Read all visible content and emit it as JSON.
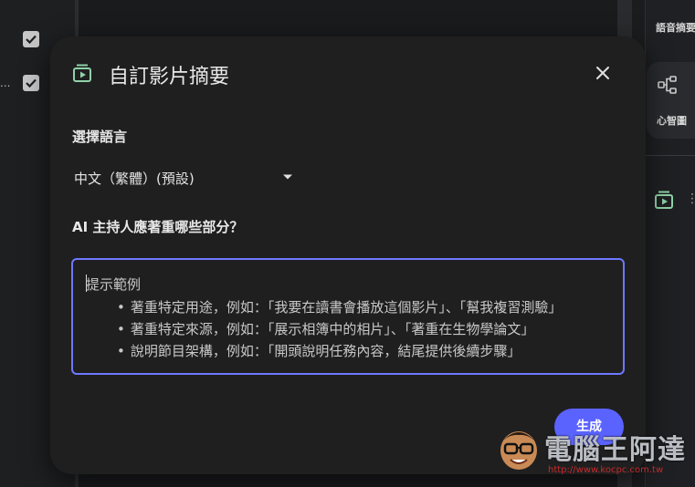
{
  "background": {
    "row_overflow": "...",
    "right_panel": {
      "top_label": "語音摘要",
      "card_label": "心智圖",
      "more": "⋮"
    }
  },
  "dialog": {
    "title": "自訂影片摘要",
    "language_label": "選擇語言",
    "language_value": "中文（繁體）(預設)",
    "focus_label": "AI 主持人應著重哪些部分？",
    "prompt": {
      "placeholder_title": "提示範例",
      "examples": [
        "著重特定用途，例如：「我要在讀書會播放這個影片」、「幫我複習測驗」",
        "著重特定來源，例如：「展示相簿中的相片」、「著重在生物學論文」",
        "說明節目架構，例如：「開頭說明任務內容，結尾提供後續步驟」"
      ]
    },
    "generate_label": "生成"
  },
  "watermark": {
    "brand": "電腦王阿達",
    "url": "http://www.kocpc.com.tw"
  },
  "colors": {
    "accent": "#5b63ff",
    "focus_border": "#6e78ff",
    "icon_green": "#8fd2a8"
  }
}
